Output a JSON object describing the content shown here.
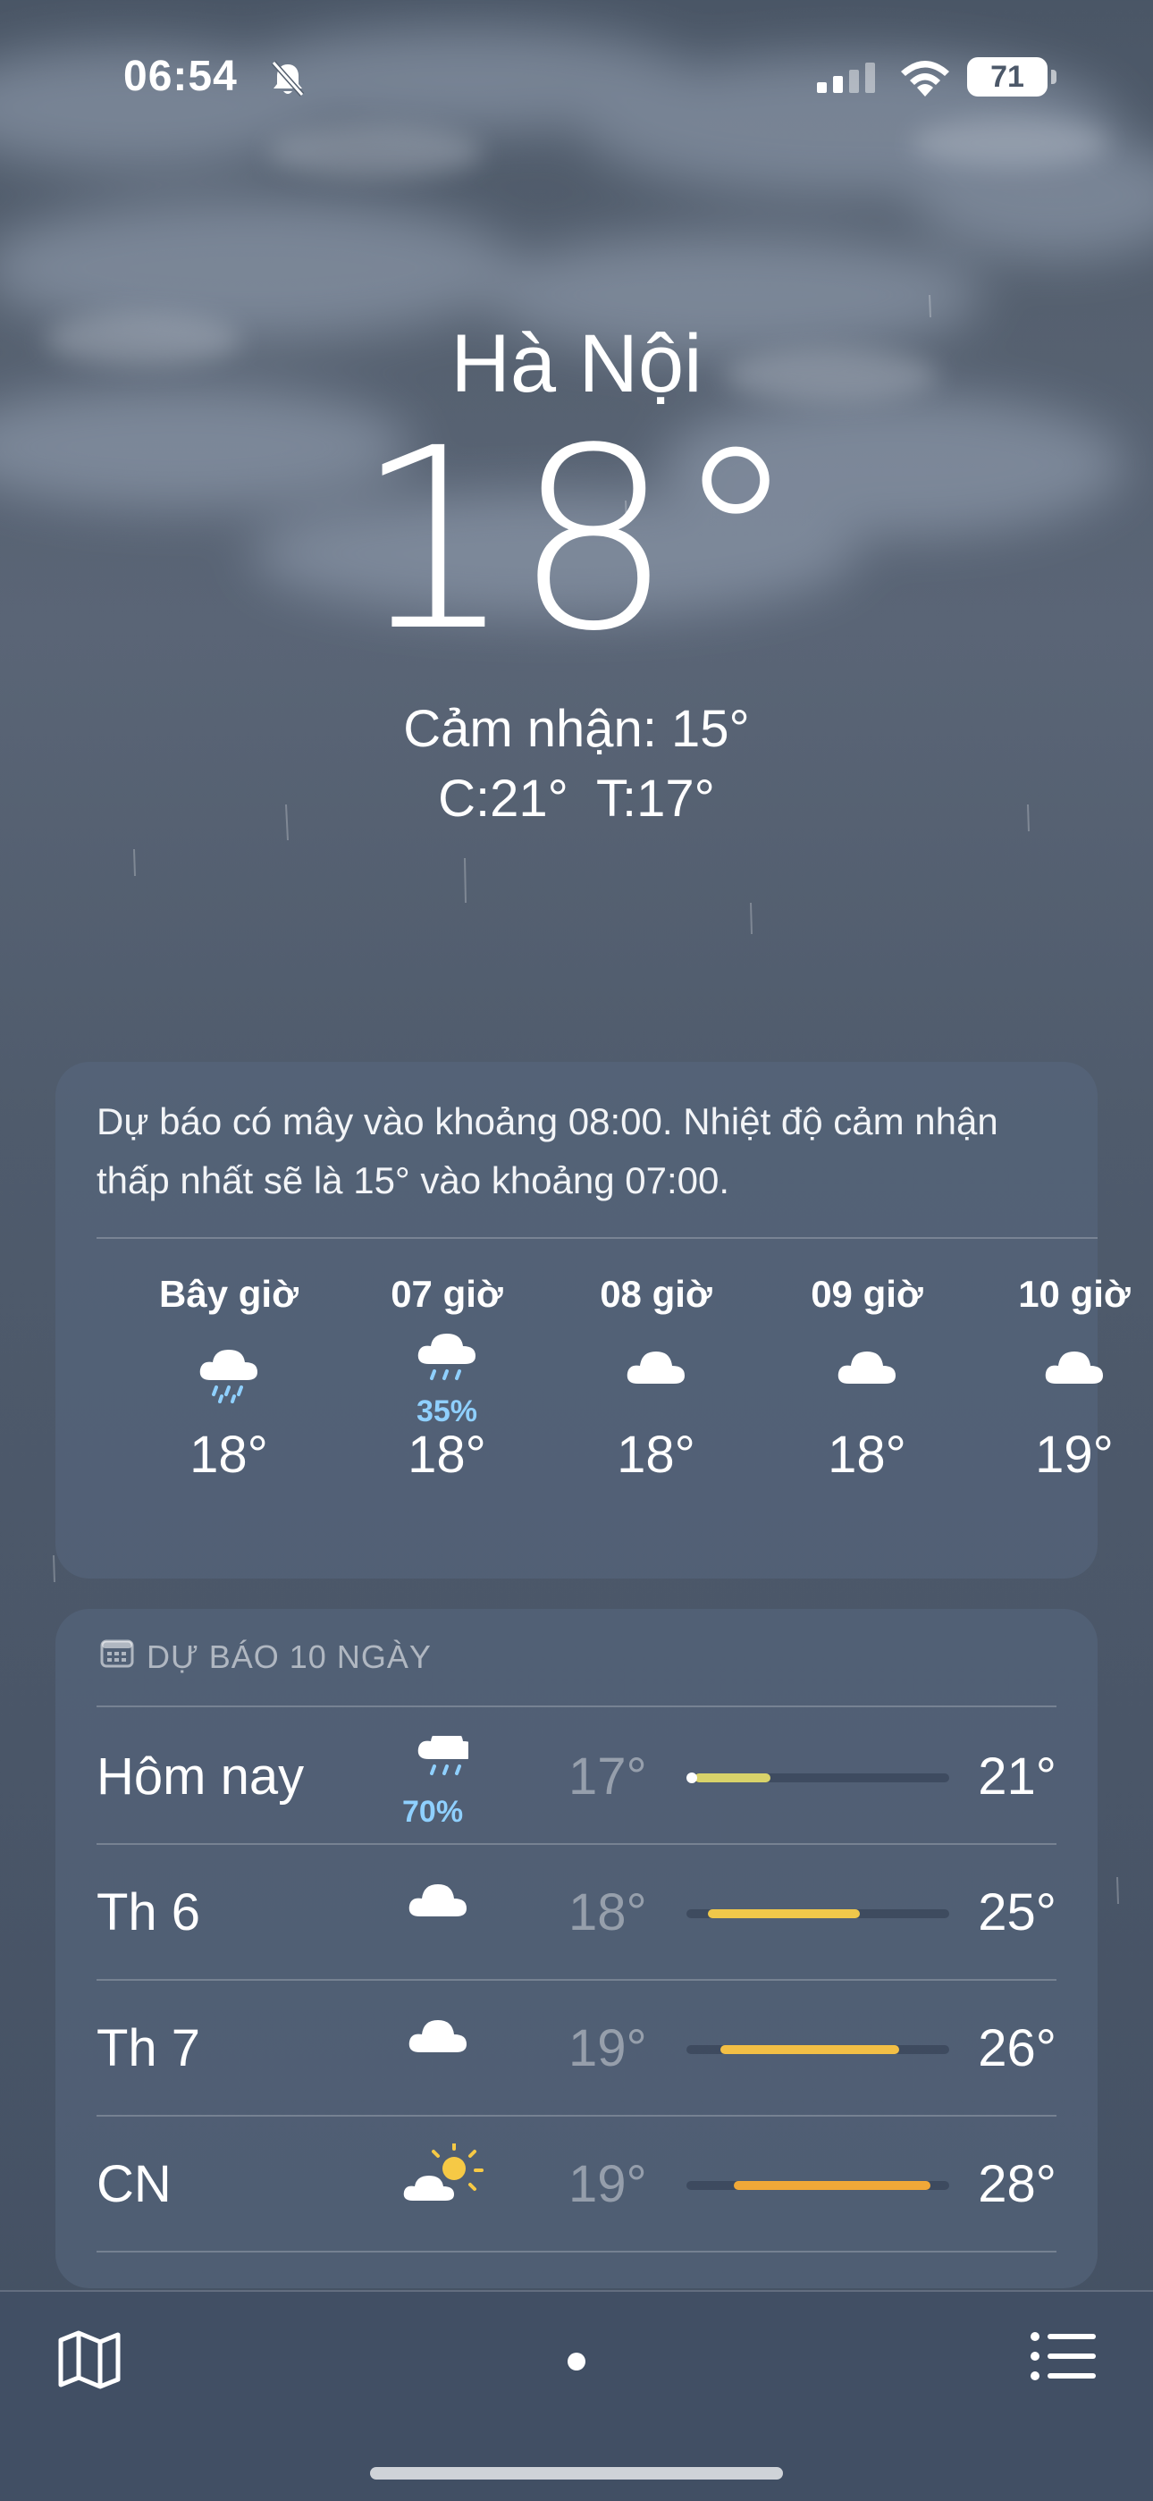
{
  "status_bar": {
    "time": "06:54",
    "battery": "71",
    "icons": [
      "bell-slash-icon",
      "cellular-signal-icon",
      "wifi-icon",
      "battery-icon"
    ]
  },
  "header": {
    "city": "Hà Nội",
    "temperature": "18°",
    "feels_like": "Cảm nhận: 15°",
    "high_low": "C:21°  T:17°"
  },
  "hourly": {
    "summary": "Dự báo có mây vào khoảng 08:00. Nhiệt độ cảm nhận thấp nhất sẽ là 15° vào khoảng 07:00.",
    "hours": [
      {
        "label": "Bây giờ",
        "icon": "cloud-drizzle-icon",
        "precip": "",
        "temp": "18°"
      },
      {
        "label": "07 giờ",
        "icon": "cloud-drizzle-icon",
        "precip": "35%",
        "temp": "18°"
      },
      {
        "label": "08 giờ",
        "icon": "cloud-icon",
        "precip": "",
        "temp": "18°"
      },
      {
        "label": "09 giờ",
        "icon": "cloud-icon",
        "precip": "",
        "temp": "18°"
      },
      {
        "label": "10 giờ",
        "icon": "cloud-icon",
        "precip": "",
        "temp": "19°"
      }
    ]
  },
  "daily": {
    "title": "DỰ BÁO 10 NGÀY",
    "days": [
      {
        "name": "Hôm nay",
        "icon": "cloud-drizzle-icon",
        "precip": "70%",
        "low": "17°",
        "high": "21°",
        "bar_start": 0.03,
        "bar_end": 0.32,
        "bar_color": "#d9d36a",
        "current_marker": 0.0
      },
      {
        "name": "Th 6",
        "icon": "cloud-icon",
        "precip": "",
        "low": "18°",
        "high": "25°",
        "bar_start": 0.08,
        "bar_end": 0.66,
        "bar_color": "#f0c84a"
      },
      {
        "name": "Th 7",
        "icon": "cloud-icon",
        "precip": "",
        "low": "19°",
        "high": "26°",
        "bar_start": 0.13,
        "bar_end": 0.81,
        "bar_color": "#f3bf45"
      },
      {
        "name": "CN",
        "icon": "cloud-sun-icon",
        "precip": "",
        "low": "19°",
        "high": "28°",
        "bar_start": 0.18,
        "bar_end": 0.93,
        "bar_color": "#f0a838"
      }
    ]
  },
  "toolbar": {
    "left_icon": "map-icon",
    "right_icon": "list-icon"
  }
}
